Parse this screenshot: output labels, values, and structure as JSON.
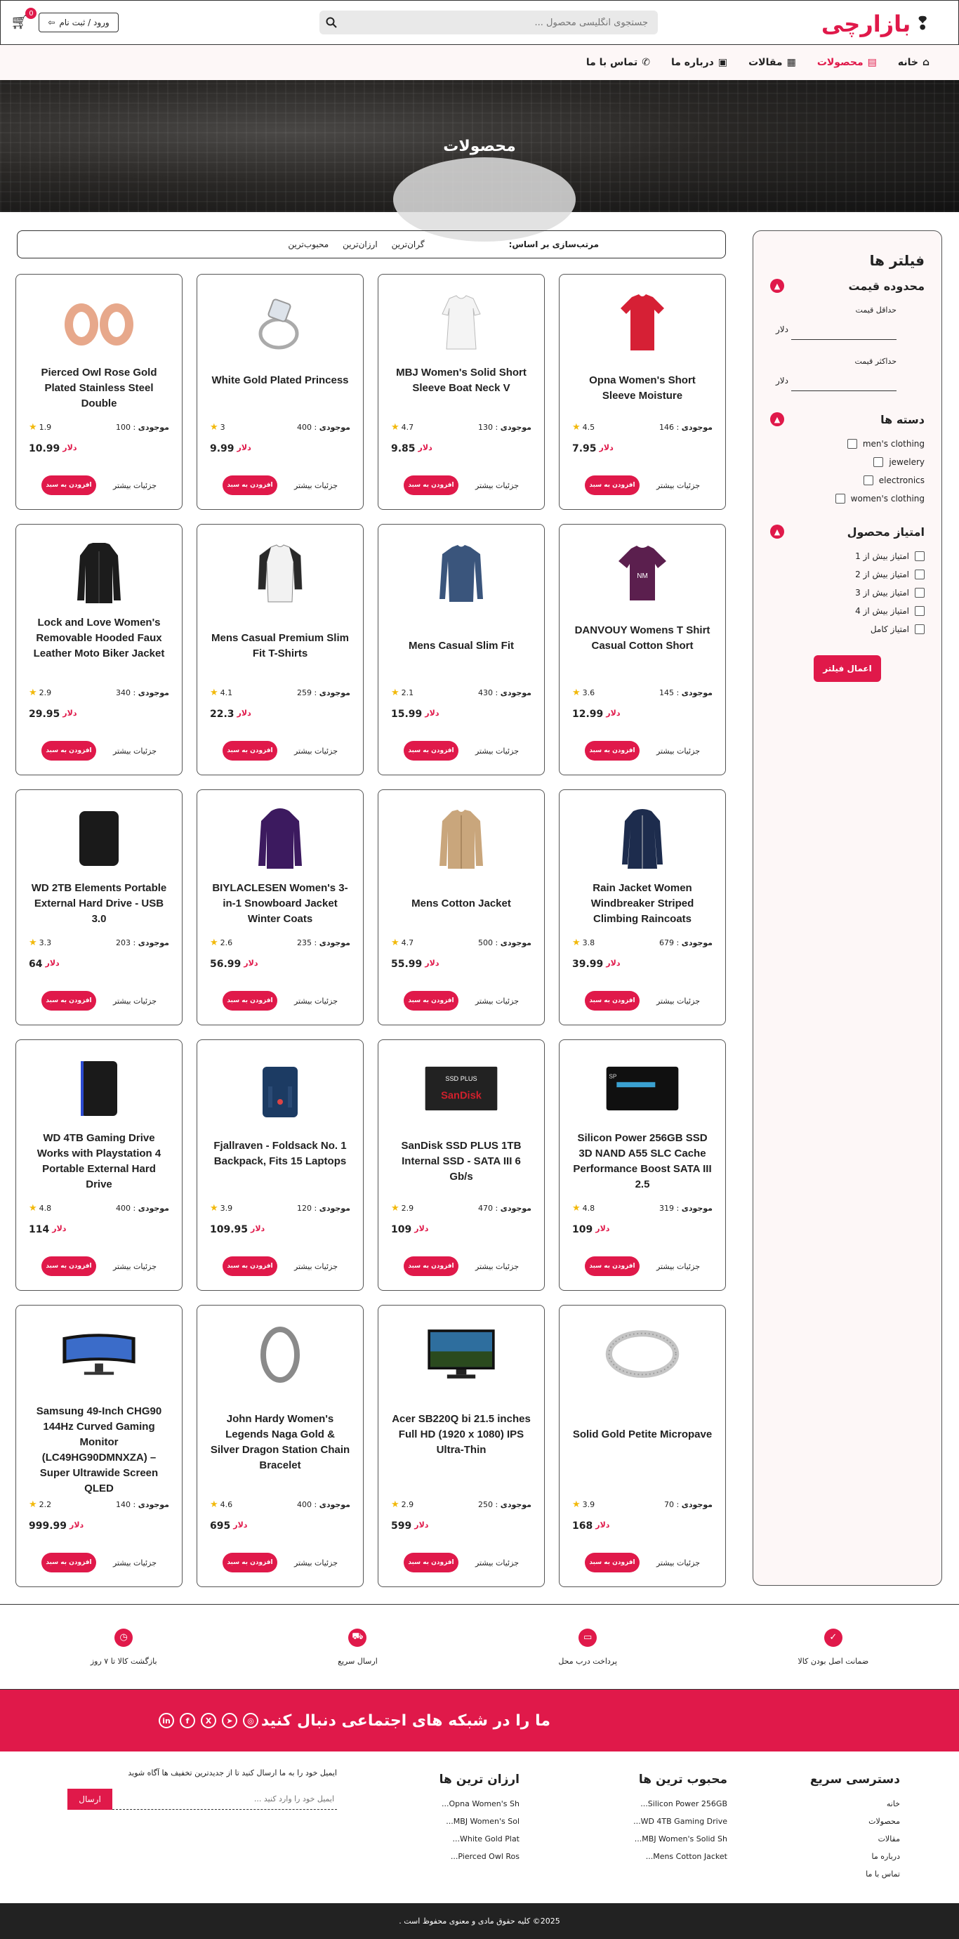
{
  "brand": {
    "logo": "بازارچی"
  },
  "search": {
    "placeholder": "جستجوی انگلیسی محصول ..."
  },
  "header": {
    "login_label": "ورود / ثبت نام",
    "cart_count": "0"
  },
  "nav": [
    {
      "label": "خانه",
      "icon": "home-icon"
    },
    {
      "label": "محصولات",
      "icon": "store-icon",
      "active": true
    },
    {
      "label": "مقالات",
      "icon": "newspaper-icon"
    },
    {
      "label": "درباره ما",
      "icon": "id-card-icon"
    },
    {
      "label": "تماس با ما",
      "icon": "phone-icon"
    }
  ],
  "hero": {
    "title": "محصولات"
  },
  "sort": {
    "title": "مرتب‌سازی بر اساس:",
    "options": [
      "گران‌ترین",
      "ارزان‌ترین",
      "محبوب‌ترین"
    ]
  },
  "filters": {
    "title": "فیلتر ها",
    "price": {
      "title": "محدوده قیمت",
      "min_label": "حداقل قیمت",
      "max_label": "حداکثر قیمت",
      "currency": "دلار"
    },
    "categories": {
      "title": "دسته ها",
      "items": [
        "men's clothing",
        "jewelery",
        "electronics",
        "women's clothing"
      ]
    },
    "rating": {
      "title": "امتیاز محصول",
      "items": [
        "امتیاز بیش از 1",
        "امتیاز بیش از 2",
        "امتیاز بیش از 3",
        "امتیاز بیش از 4",
        "امتیاز کامل"
      ]
    },
    "apply_label": "اعمال فیلتر"
  },
  "card_labels": {
    "stock": "موجودی",
    "currency": "دلار",
    "add": "افزودن به سبد",
    "details": "جزئیات بیشتر"
  },
  "products": [
    {
      "title": "Opna Women's Short Sleeve Moisture",
      "stock": "146",
      "rating": "4.5",
      "price": "7.95",
      "icon": "red-shirt"
    },
    {
      "title": "MBJ Women's Solid Short Sleeve Boat Neck V",
      "stock": "130",
      "rating": "4.7",
      "price": "9.85",
      "icon": "white-shirt"
    },
    {
      "title": "White Gold Plated Princess",
      "stock": "400",
      "rating": "3",
      "price": "9.99",
      "icon": "ring"
    },
    {
      "title": "Pierced Owl Rose Gold Plated Stainless Steel Double",
      "stock": "100",
      "rating": "1.9",
      "price": "10.99",
      "icon": "plugs"
    },
    {
      "title": "DANVOUY Womens T Shirt Casual Cotton Short",
      "stock": "145",
      "rating": "3.6",
      "price": "12.99",
      "icon": "purple-tshirt"
    },
    {
      "title": "Mens Casual Slim Fit",
      "stock": "430",
      "rating": "2.1",
      "price": "15.99",
      "icon": "blue-longsleeve"
    },
    {
      "title": "Mens Casual Premium Slim Fit T-Shirts",
      "stock": "259",
      "rating": "4.1",
      "price": "22.3",
      "icon": "raglan-tee"
    },
    {
      "title": "Lock and Love Women's Removable Hooded Faux Leather Moto Biker Jacket",
      "stock": "340",
      "rating": "2.9",
      "price": "29.95",
      "icon": "black-jacket"
    },
    {
      "title": "Rain Jacket Women Windbreaker Striped Climbing Raincoats",
      "stock": "679",
      "rating": "3.8",
      "price": "39.99",
      "icon": "navy-raincoat"
    },
    {
      "title": "Mens Cotton Jacket",
      "stock": "500",
      "rating": "4.7",
      "price": "55.99",
      "icon": "tan-jacket"
    },
    {
      "title": "BIYLACLESEN Women's 3-in-1 Snowboard Jacket Winter Coats",
      "stock": "235",
      "rating": "2.6",
      "price": "56.99",
      "icon": "purple-coat"
    },
    {
      "title": "WD 2TB Elements Portable External Hard Drive - USB 3.0",
      "stock": "203",
      "rating": "3.3",
      "price": "64",
      "icon": "black-drive"
    },
    {
      "title": "Silicon Power 256GB SSD 3D NAND A55 SLC Cache Performance Boost SATA III 2.5",
      "stock": "319",
      "rating": "4.8",
      "price": "109",
      "icon": "ssd-silicon"
    },
    {
      "title": "SanDisk SSD PLUS 1TB Internal SSD - SATA III 6 Gb/s",
      "stock": "470",
      "rating": "2.9",
      "price": "109",
      "icon": "ssd-sandisk"
    },
    {
      "title": "Fjallraven - Foldsack No. 1 Backpack, Fits 15 Laptops",
      "stock": "120",
      "rating": "3.9",
      "price": "109.95",
      "icon": "backpack"
    },
    {
      "title": "WD 4TB Gaming Drive Works with Playstation 4 Portable External Hard Drive",
      "stock": "400",
      "rating": "4.8",
      "price": "114",
      "icon": "blue-drive"
    },
    {
      "title": "Solid Gold Petite Micropave",
      "stock": "70",
      "rating": "3.9",
      "price": "168",
      "icon": "silver-ring"
    },
    {
      "title": "Acer SB220Q bi 21.5 inches Full HD (1920 x 1080) IPS Ultra-Thin",
      "stock": "250",
      "rating": "2.9",
      "price": "599",
      "icon": "monitor"
    },
    {
      "title": "John Hardy Women's Legends Naga Gold & Silver Dragon Station Chain Bracelet",
      "stock": "400",
      "rating": "4.6",
      "price": "695",
      "icon": "bracelet"
    },
    {
      "title": "Samsung 49-Inch CHG90 144Hz Curved Gaming Monitor (LC49HG90DMNXZA) – Super Ultrawide Screen QLED",
      "stock": "140",
      "rating": "2.2",
      "price": "999.99",
      "icon": "curved-monitor"
    }
  ],
  "features": [
    {
      "label": "ضمانت اصل بودن کالا",
      "icon": "check-circle-icon"
    },
    {
      "label": "پرداخت درب محل",
      "icon": "credit-card-icon"
    },
    {
      "label": "ارسال سریع",
      "icon": "truck-icon"
    },
    {
      "label": "بازگشت کالا تا ۷ روز",
      "icon": "clock-icon"
    }
  ],
  "social": {
    "title": "ما را در شبکه های اجتماعی دنبال کنید",
    "icons": [
      "in",
      "f",
      "X",
      "➤",
      "◎"
    ]
  },
  "footer": {
    "quick": {
      "title": "دسترسی سریع",
      "links": [
        "خانه",
        "محصولات",
        "مقالات",
        "درباره ما",
        "تماس با ما"
      ]
    },
    "popular": {
      "title": "محبوب ترین ها",
      "links": [
        "Silicon Power 256GB...",
        "WD 4TB Gaming Drive...",
        "MBJ Women's Solid Sh...",
        "Mens Cotton Jacket..."
      ]
    },
    "cheapest": {
      "title": "ارزان ترین ها",
      "links": [
        "Opna Women's Sh...",
        "MBJ Women's Sol...",
        "White Gold Plat...",
        "Pierced Owl Ros..."
      ]
    },
    "newsletter": {
      "text": "ایمیل خود را به ما ارسال کنید تا از جدیدترین تخفیف ها آگاه شوید",
      "placeholder": "ایمیل خود را وارد کنید ...",
      "button": "ارسال"
    },
    "copyright": "2025© کلیه حقوق مادی و معنوی محفوظ است ."
  },
  "colors": {
    "accent": "#e0194a",
    "dark": "#222222",
    "panel": "#fdf7f7"
  }
}
